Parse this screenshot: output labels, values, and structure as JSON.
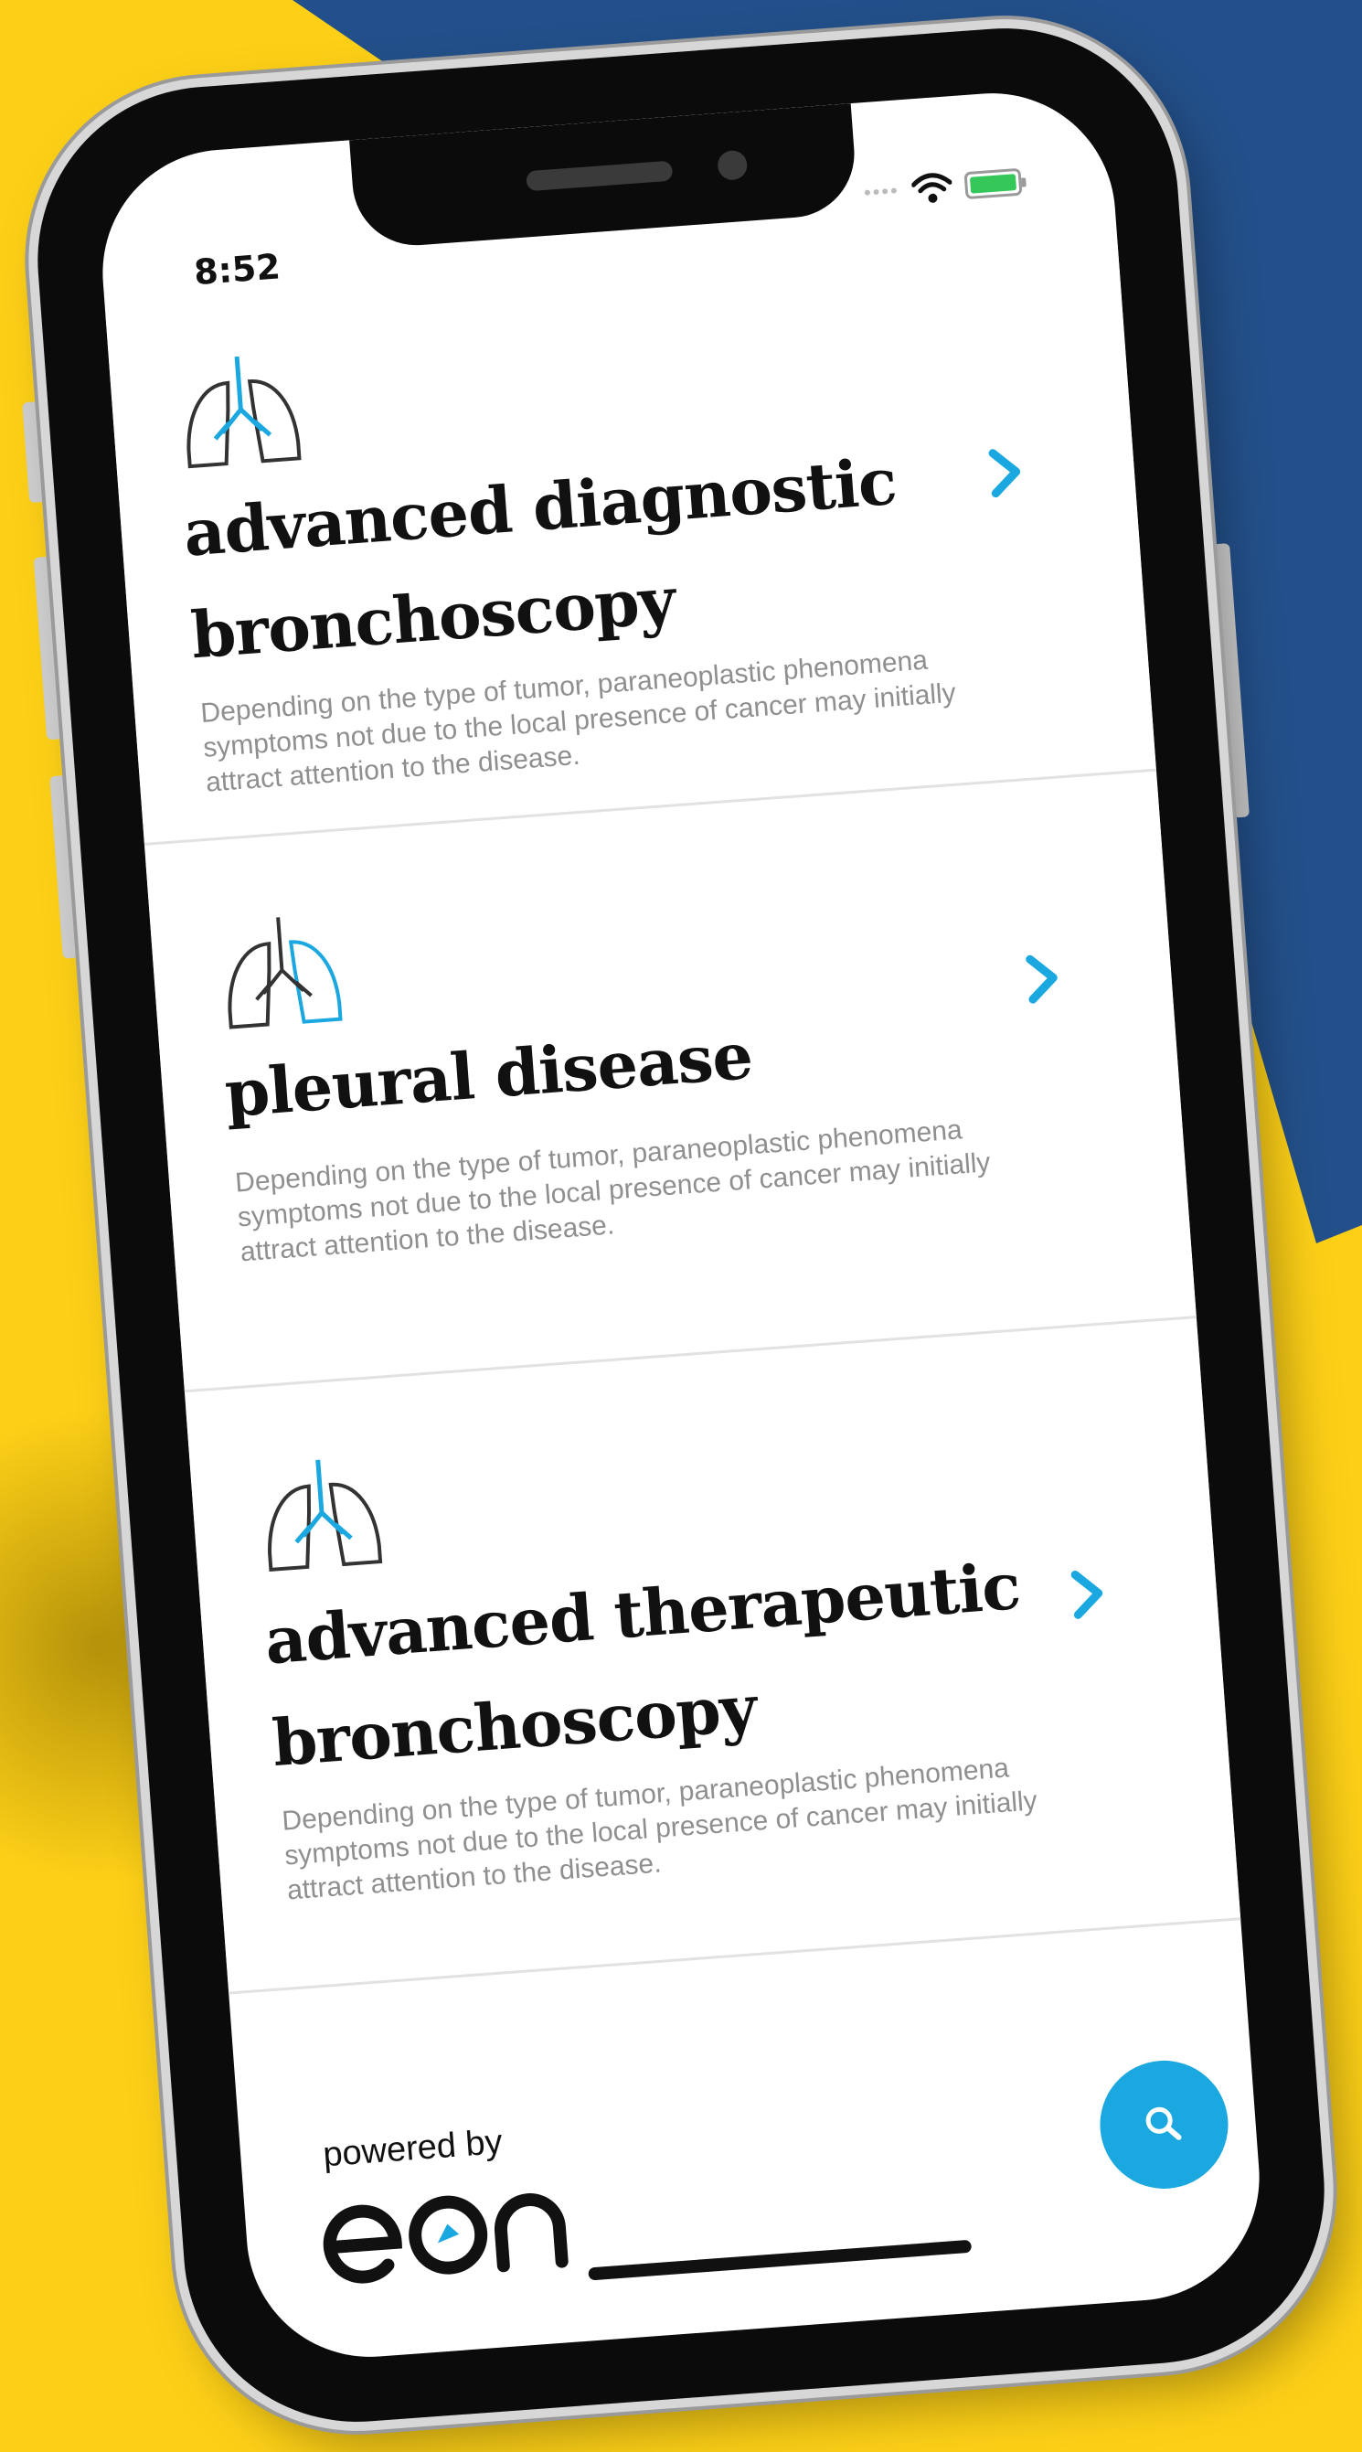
{
  "theme": {
    "background_yellow": "#FDD017",
    "background_navy": "#23508A",
    "accent_blue": "#1BA8E0"
  },
  "status_bar": {
    "time": "8:52",
    "wifi_icon": "wifi-icon",
    "battery_icon": "battery-charging-icon"
  },
  "cards": [
    {
      "icon": "lungs-trachea-icon",
      "title_line1": "advanced diagnostic",
      "title_line2": "bronchoscopy",
      "description": "Depending on the type of tumor, paraneoplastic phenomena  symptoms not due to the local presence of cancer may initially attract attention to the disease."
    },
    {
      "icon": "lungs-pleura-icon",
      "title_line1": "pleural disease",
      "title_line2": "",
      "description": "Depending on the type of tumor, paraneoplastic phenomena  symptoms not due to the local presence of cancer may initially attract attention to the disease."
    },
    {
      "icon": "lungs-trachea-icon",
      "title_line1": "advanced therapeutic",
      "title_line2": "bronchoscopy",
      "description": "Depending on the type of tumor, paraneoplastic phenomena  symptoms not due to the local presence of cancer may initially attract attention to the disease."
    }
  ],
  "footer": {
    "powered_by": "powered by",
    "logo_text": "eon",
    "search_icon": "search-icon"
  }
}
